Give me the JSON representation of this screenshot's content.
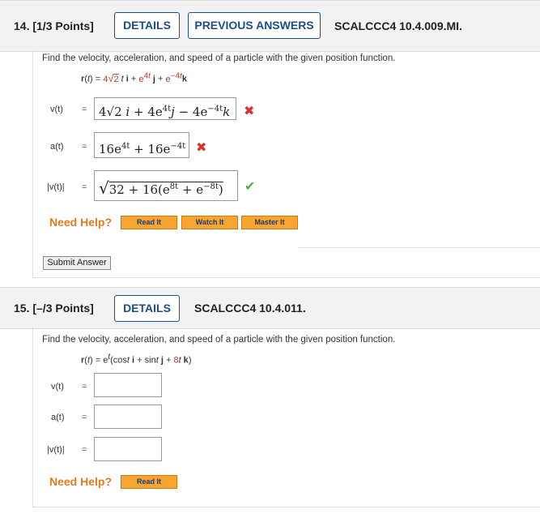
{
  "q14": {
    "number": "14.",
    "points": "[1/3 Points]",
    "details_label": "DETAILS",
    "previous_label": "PREVIOUS ANSWERS",
    "code": "SCALCCC4 10.4.009.MI.",
    "prompt": "Find the velocity, acceleration, and speed of a particle with the given position function.",
    "position_function": "r(t) = 4√2 t i + e^(4t) j + e^(−4t) k",
    "labels": {
      "v": "v(t)",
      "a": "a(t)",
      "speed": "|v(t)|",
      "eq": "="
    },
    "answers": {
      "v": "4√2 i + 4e^(4t) j − 4e^(−4t) k",
      "a": "16e^(4t) + 16e^(−4t)",
      "speed": "√(32 + 16(e^(8t) + e^(−8t)))"
    },
    "need_help": "Need Help?",
    "help_buttons": [
      "Read It",
      "Watch It",
      "Master It"
    ],
    "submit_label": "Submit Answer"
  },
  "q15": {
    "number": "15.",
    "points": "[–/3 Points]",
    "details_label": "DETAILS",
    "code": "SCALCCC4 10.4.011.",
    "prompt": "Find the velocity, acceleration, and speed of a particle with the given position function.",
    "labels": {
      "v": "v(t)",
      "a": "a(t)",
      "speed": "|v(t)|",
      "eq": "="
    },
    "need_help": "Need Help?",
    "help_buttons": [
      "Read It"
    ]
  },
  "colors": {
    "accent": "#1d4e89",
    "help_orange": "#f7a531",
    "need_help": "#e07b1c",
    "wrong": "#d9312b",
    "correct": "#4caf50",
    "red_text": "#c0392b"
  },
  "icons": [
    "wrong-x-icon",
    "correct-check-icon"
  ]
}
